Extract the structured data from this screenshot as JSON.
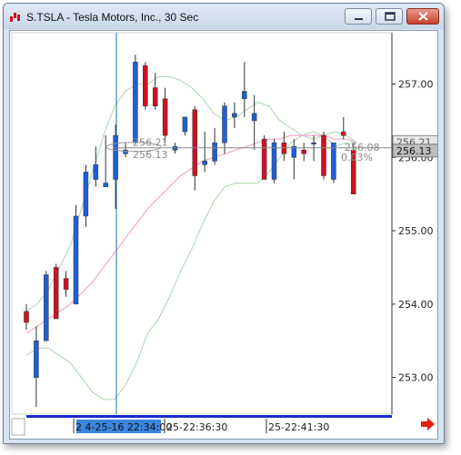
{
  "window": {
    "title": "S.TSLA - Tesla Motors, Inc., 30 Sec"
  },
  "chart_data": {
    "type": "candlestick",
    "y_ticks": [
      "257.00",
      "256.00",
      "255.00",
      "254.00",
      "253.00"
    ],
    "ylim": [
      252.5,
      257.7
    ],
    "x_labels": [
      "2 4-25-16 22:34:00",
      "25-22:36:30",
      "25-22:41:30"
    ],
    "price_badges": [
      "256.21",
      "256.13"
    ],
    "overlay_labels": [
      "256.21",
      "256.13",
      "256.08",
      "0.03%"
    ],
    "colors": {
      "up": "#1e5fd6",
      "down": "#d01020",
      "upper_band": "#b6dcb6",
      "average": "#f0a8d0",
      "cursor": "#1a6ea0"
    },
    "candles": [
      {
        "o": 253.9,
        "h": 254.0,
        "l": 253.65,
        "c": 253.75
      },
      {
        "o": 253.0,
        "h": 253.7,
        "l": 252.6,
        "c": 253.5
      },
      {
        "o": 253.5,
        "h": 254.45,
        "l": 253.5,
        "c": 254.4
      },
      {
        "o": 254.5,
        "h": 254.55,
        "l": 253.8,
        "c": 253.8
      },
      {
        "o": 254.35,
        "h": 254.45,
        "l": 254.1,
        "c": 254.2
      },
      {
        "o": 254.0,
        "h": 255.35,
        "l": 254.0,
        "c": 255.2
      },
      {
        "o": 255.2,
        "h": 255.9,
        "l": 255.05,
        "c": 255.8
      },
      {
        "o": 255.7,
        "h": 256.15,
        "l": 255.6,
        "c": 255.9
      },
      {
        "o": 255.6,
        "h": 256.3,
        "l": 255.6,
        "c": 255.65
      },
      {
        "o": 255.7,
        "h": 256.45,
        "l": 255.3,
        "c": 256.3
      },
      {
        "o": 256.05,
        "h": 256.2,
        "l": 256.0,
        "c": 256.1
      },
      {
        "o": 256.2,
        "h": 257.4,
        "l": 256.2,
        "c": 257.3
      },
      {
        "o": 257.25,
        "h": 257.3,
        "l": 256.65,
        "c": 256.7
      },
      {
        "o": 256.95,
        "h": 257.15,
        "l": 256.65,
        "c": 256.7
      },
      {
        "o": 256.8,
        "h": 256.95,
        "l": 256.2,
        "c": 256.3
      },
      {
        "o": 256.1,
        "h": 256.2,
        "l": 256.05,
        "c": 256.15
      },
      {
        "o": 256.35,
        "h": 256.55,
        "l": 256.3,
        "c": 256.55
      },
      {
        "o": 256.65,
        "h": 256.7,
        "l": 255.55,
        "c": 255.75
      },
      {
        "o": 255.9,
        "h": 256.35,
        "l": 255.8,
        "c": 255.95
      },
      {
        "o": 255.95,
        "h": 256.4,
        "l": 255.9,
        "c": 256.2
      },
      {
        "o": 256.2,
        "h": 256.75,
        "l": 256.05,
        "c": 256.7
      },
      {
        "o": 256.55,
        "h": 256.75,
        "l": 256.4,
        "c": 256.6
      },
      {
        "o": 256.8,
        "h": 257.3,
        "l": 256.55,
        "c": 256.9
      },
      {
        "o": 256.5,
        "h": 256.85,
        "l": 256.1,
        "c": 256.6
      },
      {
        "o": 256.25,
        "h": 256.3,
        "l": 255.7,
        "c": 255.7
      },
      {
        "o": 255.7,
        "h": 256.25,
        "l": 255.65,
        "c": 256.2
      },
      {
        "o": 256.2,
        "h": 256.35,
        "l": 255.95,
        "c": 256.05
      },
      {
        "o": 256.0,
        "h": 256.25,
        "l": 255.7,
        "c": 256.15
      },
      {
        "o": 256.1,
        "h": 256.2,
        "l": 255.95,
        "c": 256.05
      },
      {
        "o": 256.2,
        "h": 256.3,
        "l": 255.95,
        "c": 256.2
      },
      {
        "o": 256.3,
        "h": 256.35,
        "l": 255.7,
        "c": 255.75
      },
      {
        "o": 255.7,
        "h": 256.15,
        "l": 255.65,
        "c": 256.2
      },
      {
        "o": 256.35,
        "h": 256.55,
        "l": 256.25,
        "c": 256.3
      },
      {
        "o": 256.1,
        "h": 256.2,
        "l": 255.5,
        "c": 255.5
      }
    ],
    "upper_band": [
      253.9,
      254.0,
      254.2,
      254.5,
      254.8,
      255.3,
      255.8,
      256.3,
      256.7,
      256.9,
      257.0,
      257.0,
      257.1,
      257.1,
      257.05,
      256.95,
      256.8,
      256.6,
      256.5,
      256.55,
      256.65,
      256.75,
      256.7,
      256.5,
      256.4,
      256.3,
      256.25,
      256.3,
      256.35,
      256.3,
      256.2
    ],
    "average_line": [
      253.6,
      253.7,
      253.8,
      253.9,
      254.0,
      254.15,
      254.3,
      254.5,
      254.7,
      254.9,
      255.1,
      255.3,
      255.45,
      255.6,
      255.75,
      255.85,
      255.95,
      256.0,
      256.05,
      256.1,
      256.15,
      256.2,
      256.25,
      256.25,
      256.3,
      256.3,
      256.3,
      256.3,
      256.25,
      256.25,
      256.2
    ]
  }
}
